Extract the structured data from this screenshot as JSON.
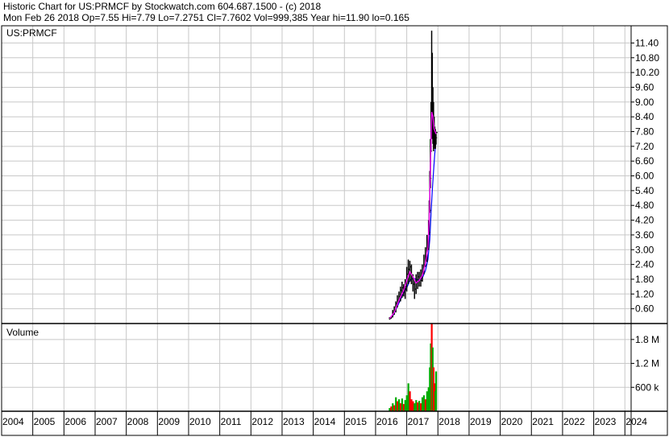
{
  "header": {
    "line1": "Historic Chart for US:PRMCF by Stockwatch.com 604.687.1500 - (c) 2018",
    "line2": "Mon Feb 26 2018   Op=7.55   Hi=7.79   Lo=7.2751   Cl=7.7602   Vol=999,385   Year hi=11.90   lo=0.165"
  },
  "colors": {
    "background": "#ffffff",
    "grid": "#c8c8c8",
    "price_bar": "#000000",
    "ma_short": "#ff00ff",
    "ma_long": "#0000ff",
    "volume_up": "#00aa00",
    "volume_down": "#ff0000",
    "axis": "#000000"
  },
  "chart_data": [
    {
      "type": "line",
      "title": "US:PRMCF",
      "x_unit": "year",
      "xlim": [
        2004,
        2024.2
      ],
      "ylim": [
        0,
        12.1
      ],
      "grid": true,
      "y_ticks": [
        "0.60",
        "1.20",
        "1.80",
        "2.40",
        "3.00",
        "3.60",
        "4.20",
        "4.80",
        "5.40",
        "6.00",
        "6.60",
        "7.20",
        "7.80",
        "8.40",
        "9.00",
        "9.60",
        "10.20",
        "10.80",
        "11.40"
      ],
      "price_hlc": [
        [
          2016.45,
          0.26,
          0.16,
          0.2
        ],
        [
          2016.5,
          0.3,
          0.2,
          0.26
        ],
        [
          2016.55,
          0.55,
          0.25,
          0.45
        ],
        [
          2016.6,
          0.7,
          0.35,
          0.55
        ],
        [
          2016.65,
          0.9,
          0.45,
          0.8
        ],
        [
          2016.7,
          1.15,
          0.65,
          0.95
        ],
        [
          2016.75,
          1.3,
          0.85,
          1.1
        ],
        [
          2016.8,
          1.5,
          0.9,
          1.35
        ],
        [
          2016.85,
          1.7,
          1.05,
          1.45
        ],
        [
          2016.9,
          1.6,
          1.1,
          1.35
        ],
        [
          2016.95,
          1.8,
          1.0,
          1.5
        ],
        [
          2017.0,
          2.3,
          1.3,
          2.0
        ],
        [
          2017.05,
          2.6,
          1.6,
          2.2
        ],
        [
          2017.1,
          2.55,
          1.7,
          2.3
        ],
        [
          2017.15,
          2.4,
          1.6,
          1.9
        ],
        [
          2017.2,
          2.0,
          1.3,
          1.6
        ],
        [
          2017.25,
          1.8,
          1.0,
          1.4
        ],
        [
          2017.3,
          2.0,
          1.2,
          1.7
        ],
        [
          2017.35,
          2.1,
          1.4,
          1.9
        ],
        [
          2017.4,
          2.1,
          1.5,
          1.8
        ],
        [
          2017.45,
          2.2,
          1.5,
          1.75
        ],
        [
          2017.5,
          2.4,
          1.7,
          2.1
        ],
        [
          2017.55,
          2.8,
          2.0,
          2.4
        ],
        [
          2017.6,
          3.1,
          2.3,
          2.6
        ],
        [
          2017.65,
          3.6,
          2.5,
          3.0
        ],
        [
          2017.7,
          4.2,
          3.0,
          3.7
        ],
        [
          2017.72,
          5.0,
          3.6,
          4.6
        ],
        [
          2017.74,
          6.2,
          4.5,
          5.9
        ],
        [
          2017.76,
          7.5,
          5.5,
          7.0
        ],
        [
          2017.78,
          9.0,
          7.0,
          8.5
        ],
        [
          2017.8,
          11.9,
          8.0,
          9.5
        ],
        [
          2017.82,
          11.0,
          7.5,
          8.6
        ],
        [
          2017.84,
          9.6,
          7.3,
          8.2
        ],
        [
          2017.86,
          9.0,
          7.0,
          7.9
        ],
        [
          2017.88,
          8.4,
          7.1,
          7.5
        ],
        [
          2017.9,
          8.0,
          7.2,
          7.6
        ],
        [
          2017.92,
          7.9,
          7.1,
          7.55
        ],
        [
          2017.94,
          7.79,
          7.2751,
          7.7602
        ]
      ],
      "ma_short": [
        [
          2016.45,
          0.2
        ],
        [
          2016.6,
          0.45
        ],
        [
          2016.75,
          0.95
        ],
        [
          2016.9,
          1.35
        ],
        [
          2017.0,
          1.75
        ],
        [
          2017.1,
          2.1
        ],
        [
          2017.2,
          1.9
        ],
        [
          2017.3,
          1.65
        ],
        [
          2017.4,
          1.75
        ],
        [
          2017.5,
          1.95
        ],
        [
          2017.6,
          2.45
        ],
        [
          2017.68,
          3.1
        ],
        [
          2017.72,
          4.3
        ],
        [
          2017.76,
          6.3
        ],
        [
          2017.8,
          8.6
        ],
        [
          2017.84,
          8.4
        ],
        [
          2017.88,
          7.9
        ],
        [
          2017.94,
          7.7
        ]
      ],
      "ma_long": [
        [
          2016.55,
          0.3
        ],
        [
          2016.7,
          0.7
        ],
        [
          2016.85,
          1.1
        ],
        [
          2017.0,
          1.45
        ],
        [
          2017.1,
          1.75
        ],
        [
          2017.2,
          1.85
        ],
        [
          2017.3,
          1.8
        ],
        [
          2017.4,
          1.75
        ],
        [
          2017.5,
          1.85
        ],
        [
          2017.6,
          2.15
        ],
        [
          2017.68,
          2.6
        ],
        [
          2017.74,
          3.4
        ],
        [
          2017.78,
          4.5
        ],
        [
          2017.82,
          5.4
        ],
        [
          2017.86,
          6.2
        ],
        [
          2017.9,
          6.9
        ],
        [
          2017.94,
          7.4
        ]
      ]
    },
    {
      "type": "bar",
      "title": "Volume",
      "x_unit": "year",
      "xlim": [
        2004,
        2024.2
      ],
      "ylim": [
        0,
        2200000
      ],
      "grid": true,
      "y_ticks": [
        {
          "value": 600000,
          "label": "600 k"
        },
        {
          "value": 1200000,
          "label": "1.2 M"
        },
        {
          "value": 1800000,
          "label": "1.8 M"
        }
      ],
      "x_labels": [
        "2004",
        "2005",
        "2006",
        "2007",
        "2008",
        "2009",
        "2010",
        "2011",
        "2012",
        "2013",
        "2014",
        "2015",
        "2016",
        "2017",
        "2018",
        "2019",
        "2020",
        "2021",
        "2022",
        "2023",
        "2024"
      ],
      "bars": [
        [
          2016.45,
          80000,
          "up"
        ],
        [
          2016.5,
          120000,
          "down"
        ],
        [
          2016.55,
          200000,
          "up"
        ],
        [
          2016.6,
          150000,
          "down"
        ],
        [
          2016.65,
          350000,
          "up"
        ],
        [
          2016.7,
          250000,
          "down"
        ],
        [
          2016.75,
          300000,
          "up"
        ],
        [
          2016.8,
          200000,
          "down"
        ],
        [
          2016.85,
          320000,
          "up"
        ],
        [
          2016.9,
          180000,
          "down"
        ],
        [
          2016.95,
          280000,
          "up"
        ],
        [
          2017.0,
          400000,
          "up"
        ],
        [
          2017.05,
          700000,
          "up"
        ],
        [
          2017.1,
          500000,
          "down"
        ],
        [
          2017.15,
          300000,
          "down"
        ],
        [
          2017.2,
          250000,
          "down"
        ],
        [
          2017.25,
          200000,
          "up"
        ],
        [
          2017.3,
          280000,
          "up"
        ],
        [
          2017.35,
          220000,
          "down"
        ],
        [
          2017.4,
          260000,
          "up"
        ],
        [
          2017.45,
          200000,
          "down"
        ],
        [
          2017.5,
          350000,
          "up"
        ],
        [
          2017.55,
          400000,
          "up"
        ],
        [
          2017.6,
          300000,
          "down"
        ],
        [
          2017.65,
          500000,
          "up"
        ],
        [
          2017.7,
          600000,
          "up"
        ],
        [
          2017.74,
          1100000,
          "up"
        ],
        [
          2017.77,
          1700000,
          "up"
        ],
        [
          2017.8,
          2400000,
          "down"
        ],
        [
          2017.83,
          1600000,
          "up"
        ],
        [
          2017.86,
          1100000,
          "down"
        ],
        [
          2017.89,
          700000,
          "down"
        ],
        [
          2017.92,
          500000,
          "up"
        ],
        [
          2017.94,
          999385,
          "up"
        ]
      ]
    }
  ]
}
